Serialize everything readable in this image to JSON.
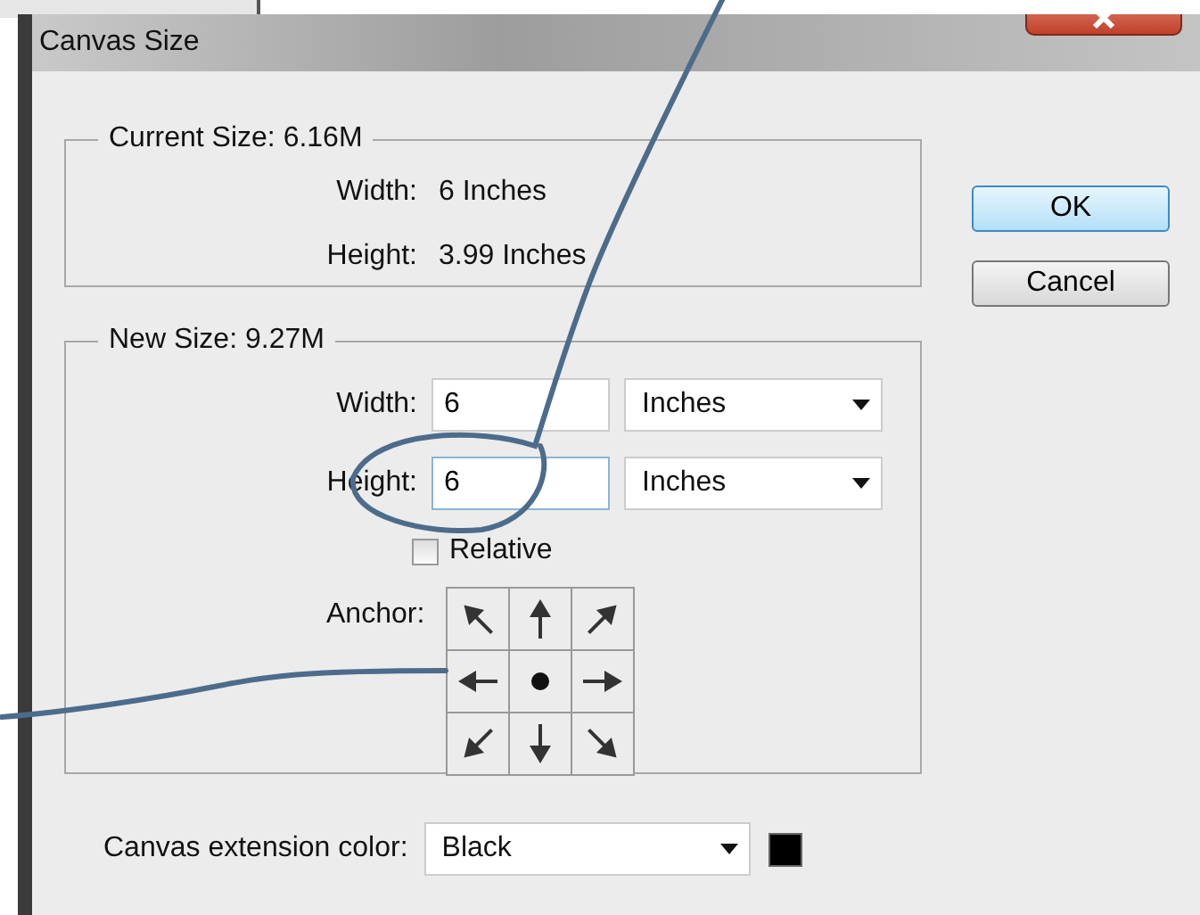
{
  "window": {
    "title": "Canvas Size"
  },
  "current_size": {
    "legend": "Current Size: 6.16M",
    "rows": [
      {
        "label": "Width:",
        "value": "6 Inches"
      },
      {
        "label": "Height:",
        "value": "3.99 Inches"
      }
    ]
  },
  "new_size": {
    "legend": "New Size: 9.27M",
    "fields": [
      {
        "label": "Width:",
        "value": "6",
        "unit": "Inches",
        "focused": false
      },
      {
        "label": "Height:",
        "value": "6",
        "unit": "Inches",
        "focused": true
      }
    ],
    "relative": {
      "label": "Relative",
      "checked": false
    },
    "anchor": {
      "label": "Anchor:",
      "cells": [
        {
          "selected": false
        },
        {
          "selected": false
        },
        {
          "selected": false
        },
        {
          "selected": false
        },
        {
          "selected": true
        },
        {
          "selected": false
        },
        {
          "selected": false
        },
        {
          "selected": false
        },
        {
          "selected": false
        }
      ]
    }
  },
  "extension_color": {
    "label": "Canvas extension color:",
    "value": "Black",
    "color": "#000000"
  },
  "buttons": [
    {
      "label": "OK",
      "default": true
    },
    {
      "label": "Cancel",
      "default": false
    }
  ]
}
